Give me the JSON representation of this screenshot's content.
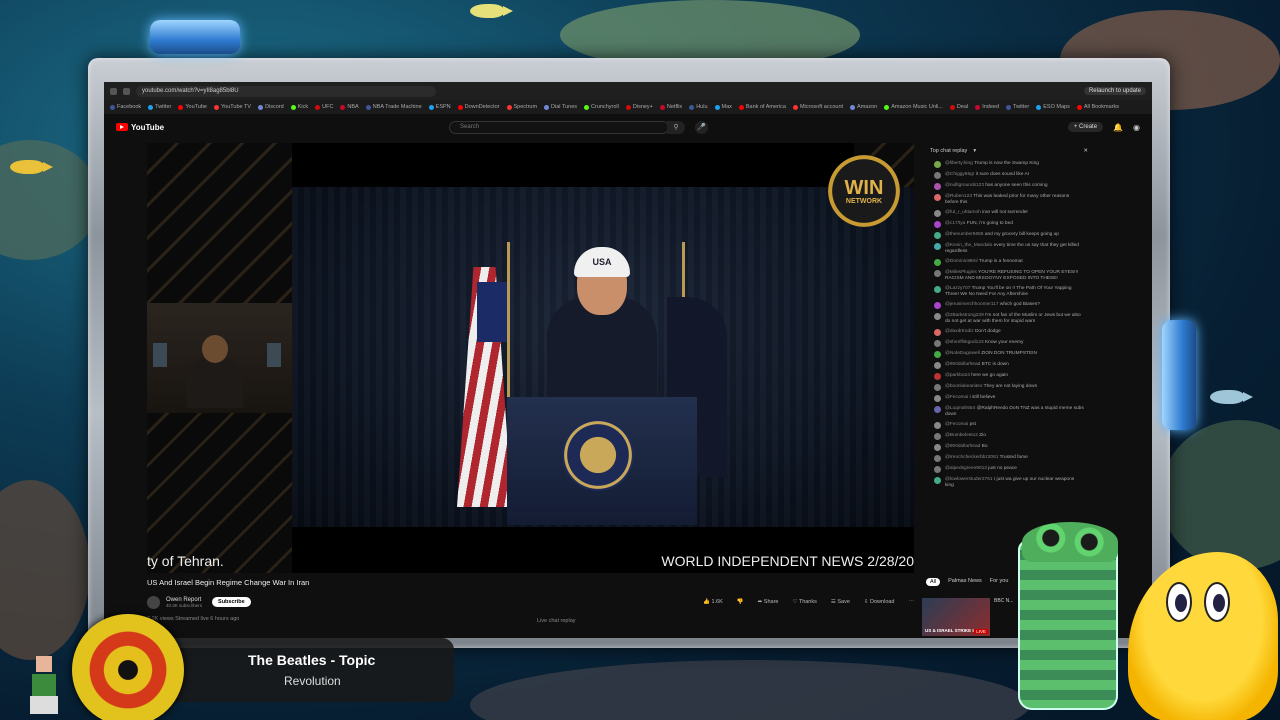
{
  "browser": {
    "url": "youtube.com/watch?v=yIl8ag85bl8U",
    "relaunch_label": "Relaunch to update",
    "bookmarks": [
      "Facebook",
      "Twitter",
      "YouTube",
      "YouTube TV",
      "Discord",
      "Kick",
      "UFC",
      "NBA",
      "NBA Trade Machine",
      "ESPN",
      "DownDetector",
      "Spectrum",
      "Dial Tunes",
      "Crunchyroll",
      "Disney+",
      "Netflix",
      "Hulu",
      "Max",
      "Bank of America",
      "Microsoft account",
      "Amazon",
      "Amazon Music Unli...",
      "Deal",
      "Indeed",
      "Twitter",
      "ESO Maps",
      "All Bookmarks"
    ]
  },
  "youtube": {
    "logo_text": "YouTube",
    "search_placeholder": "Search",
    "create_label": "+ Create"
  },
  "video": {
    "overlay_logo_big": "WIN",
    "overlay_logo_small": "NETWORK",
    "cap_text": "USA",
    "ticker_left": "ty of Tehran.",
    "ticker_right": "WORLD INDEPENDENT NEWS 2/28/20",
    "title": "US And Israel Begin Regime Change War In Iran",
    "channel": "Owen Report",
    "subscribers": "40.3K subscribers",
    "subscribe_label": "Subscribe",
    "likes": "1.6K",
    "share_label": "Share",
    "thanks_label": "Thanks",
    "save_label": "Save",
    "download_label": "Download",
    "description": "2.2K views  Streamed live 6 hours ago",
    "live_chat_replay": "Live chat replay"
  },
  "chat": {
    "header": "Top chat replay",
    "messages": [
      {
        "user": "@liberty:king",
        "text": "Trump is now the Swamp King",
        "color": "#7a4"
      },
      {
        "user": "@Chiggy55gr",
        "text": "it sure does sound like AI",
        "color": "#777"
      },
      {
        "user": "@nulltgrounds123",
        "text": "has anyone seen this coming",
        "color": "#a5a"
      },
      {
        "user": "@Ruben123",
        "text": "This was leaked prior for many other reasons before this",
        "color": "#d66"
      },
      {
        "user": "@fut_r_uhtamoh",
        "text": "iran will not surrender",
        "color": "#888"
      },
      {
        "user": "@c17/tya",
        "text": "FUN, i'm going to bed",
        "color": "#a4c"
      },
      {
        "user": "@thenumber5666",
        "text": "and my grocery bill keeps going up",
        "color": "#4a8"
      },
      {
        "user": "@Kevin_the_Mandalo",
        "text": "every time the us say that they get killed regardless",
        "color": "#4aa"
      },
      {
        "user": "@Dominic98ml",
        "text": "Trump is a fennomat",
        "color": "#4a4"
      },
      {
        "user": "@MilesPlugins",
        "text": "YOU'RE REFUSING TO OPEN YOUR EYES!!! RACISM AND MISOGYNY EXPOSED INTO THESE!",
        "color": "#777"
      },
      {
        "user": "@Lazzy707",
        "text": "Trump You'll be on !! The Path Of Your Yapping Three! We No Need For Any Aftershine",
        "color": "#4a8"
      },
      {
        "user": "@jerusimerchhoomer117",
        "text": "which god Biases?",
        "color": "#a4c"
      },
      {
        "user": "@2Barkstrong239",
        "text": "I'm not fan of the Muslim or Jews but we also do not get at war with them for stupid wars",
        "color": "#888"
      },
      {
        "user": "@daxdrtrodiz",
        "text": "Don't dodge",
        "color": "#d66"
      },
      {
        "user": "@sheriffskgod123",
        "text": "Know your enemy",
        "color": "#777"
      },
      {
        "user": "@NoteDugowell",
        "text": "ZION DON TRUMPSTEIN",
        "color": "#4a4"
      },
      {
        "user": "@900dollarhead",
        "text": "BTC is down",
        "color": "#888"
      },
      {
        "user": "@parkbo24",
        "text": "here we go again",
        "color": "#b33"
      },
      {
        "user": "@boonlukeaniteo",
        "text": "They are not laying down",
        "color": "#777"
      },
      {
        "user": "@Fecomai",
        "text": "i still believe",
        "color": "#888"
      },
      {
        "user": "@Luqmah554",
        "text": "@RalphReedo DoN TNZ was a stupid meme subs down",
        "color": "#66a"
      },
      {
        "user": "@Fecomai",
        "text": "pst",
        "color": "#888"
      },
      {
        "user": "@Bumbelesto2",
        "text": "Zio",
        "color": "#777"
      },
      {
        "user": "@900dollarhead",
        "text": "Bo",
        "color": "#888"
      },
      {
        "user": "@trenchcheckerbbz2061",
        "text": "Trusted fame",
        "color": "#777"
      },
      {
        "user": "@alpedsgreen9013",
        "text": "just no peace",
        "color": "#777"
      },
      {
        "user": "@lowlowerstuder2761",
        "text": "I just wa give up our nuclear weapons king",
        "color": "#4a8"
      }
    ]
  },
  "recommendations": {
    "chips": [
      "All",
      "Palmas News",
      "For you"
    ],
    "thumb_label": "US & ISRAEL STRIKE IRAN",
    "thumb_badge": "LIVE",
    "thumb_text": "BBC N..."
  },
  "now_playing": {
    "artist": "The Beatles - Topic",
    "track": "Revolution"
  }
}
